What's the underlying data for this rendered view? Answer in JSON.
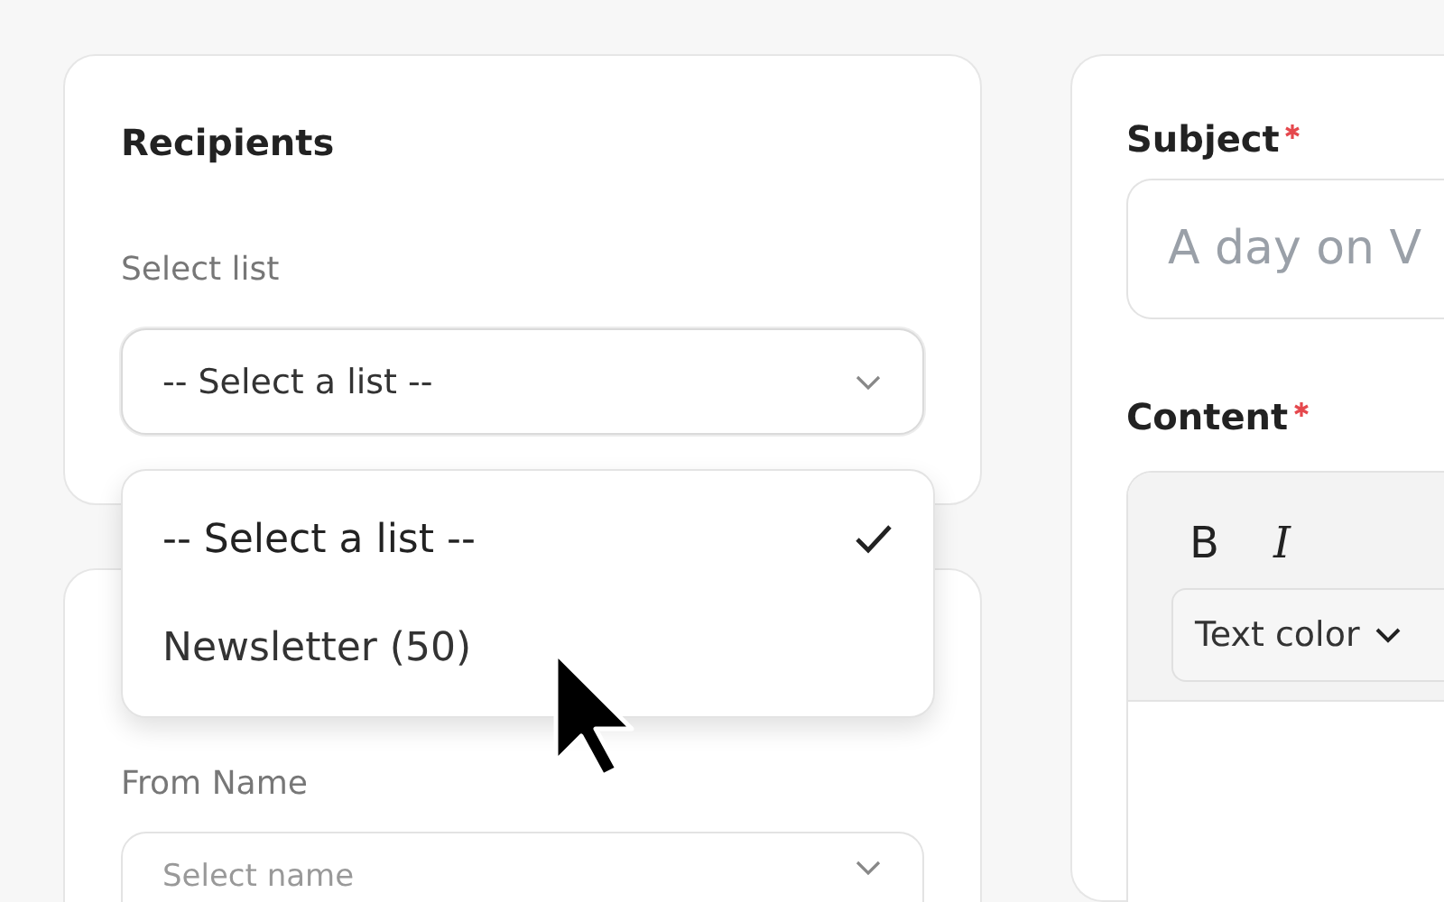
{
  "recipients": {
    "title": "Recipients",
    "list_label": "Select list",
    "list_select": {
      "value": "-- Select a list --",
      "expanded": true
    },
    "options": [
      {
        "label": "-- Select a list --",
        "selected": true
      },
      {
        "label": "Newsletter (50)",
        "selected": false
      }
    ]
  },
  "sender": {
    "from_name_label": "From Name",
    "from_name_placeholder": "Select name"
  },
  "message": {
    "subject_label": "Subject",
    "subject_required": true,
    "subject_placeholder": "A day on V",
    "content_label": "Content",
    "content_required": true,
    "toolbar": [
      {
        "kind": "bold",
        "label": "B"
      },
      {
        "kind": "italic",
        "label": "I"
      }
    ],
    "text_color_label": "Text color"
  }
}
